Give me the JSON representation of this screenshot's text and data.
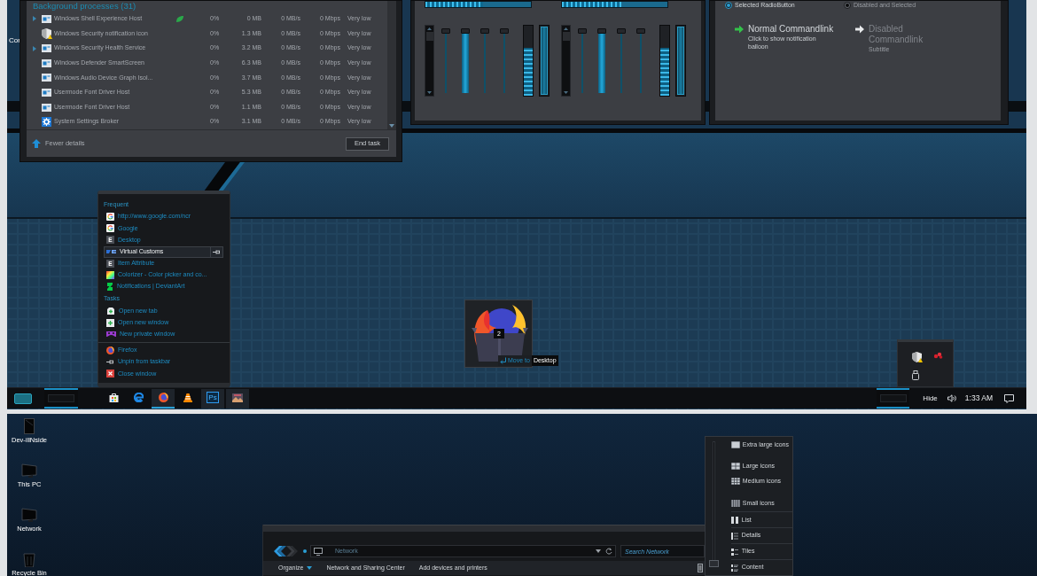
{
  "top_desktop": {
    "partial_label": "Cor"
  },
  "task_manager": {
    "section_title": "Background processes (31)",
    "rows": [
      {
        "name": "Windows Shell Experience Host",
        "cpu": "0%",
        "memory": "0 MB",
        "disk": "0 MB/s",
        "network": "0 Mbps",
        "power": "Very low",
        "expandable": true,
        "suspended": true
      },
      {
        "name": "Windows Security notification icon",
        "cpu": "0%",
        "memory": "1.3 MB",
        "disk": "0 MB/s",
        "network": "0 Mbps",
        "power": "Very low",
        "expandable": false,
        "suspended": false
      },
      {
        "name": "Windows Security Health Service",
        "cpu": "0%",
        "memory": "3.2 MB",
        "disk": "0 MB/s",
        "network": "0 Mbps",
        "power": "Very low",
        "expandable": true,
        "suspended": false
      },
      {
        "name": "Windows Defender SmartScreen",
        "cpu": "0%",
        "memory": "6.3 MB",
        "disk": "0 MB/s",
        "network": "0 Mbps",
        "power": "Very low",
        "expandable": false,
        "suspended": false
      },
      {
        "name": "Windows Audio Device Graph Isol...",
        "cpu": "0%",
        "memory": "3.7 MB",
        "disk": "0 MB/s",
        "network": "0 Mbps",
        "power": "Very low",
        "expandable": false,
        "suspended": false
      },
      {
        "name": "Usermode Font Driver Host",
        "cpu": "0%",
        "memory": "5.3 MB",
        "disk": "0 MB/s",
        "network": "0 Mbps",
        "power": "Very low",
        "expandable": false,
        "suspended": false
      },
      {
        "name": "Usermode Font Driver Host",
        "cpu": "0%",
        "memory": "1.1 MB",
        "disk": "0 MB/s",
        "network": "0 Mbps",
        "power": "Very low",
        "expandable": false,
        "suspended": false
      },
      {
        "name": "System Settings Broker",
        "cpu": "0%",
        "memory": "3.1 MB",
        "disk": "0 MB/s",
        "network": "0 Mbps",
        "power": "Very low",
        "expandable": false,
        "suspended": false
      }
    ],
    "fewer_details": "Fewer details",
    "end_task": "End task"
  },
  "slider_demo": {
    "progress_bars": [
      {
        "level": 0.55
      },
      {
        "level": 0.56
      }
    ],
    "groups": [
      {
        "sliders": [
          {
            "kind": "thin",
            "level": 1
          },
          {
            "kind": "filled",
            "level": 1
          },
          {
            "kind": "thin",
            "level": 1
          },
          {
            "kind": "thin",
            "level": 1
          }
        ],
        "meters": [
          {
            "kind": "chevron",
            "level": 0.68
          },
          {
            "kind": "solid",
            "level": 1
          }
        ]
      },
      {
        "sliders": [
          {
            "kind": "thin",
            "level": 1
          },
          {
            "kind": "filled",
            "level": 1
          },
          {
            "kind": "thin",
            "level": 1
          },
          {
            "kind": "thin",
            "level": 1
          }
        ],
        "meters": [
          {
            "kind": "chevron",
            "level": 0.68
          },
          {
            "kind": "solid",
            "level": 1
          }
        ]
      }
    ]
  },
  "options_demo": {
    "radio_buttons": [
      {
        "label": "Selected RadioButton",
        "selected": true,
        "disabled": false
      },
      {
        "label": "Disabled and Selected",
        "selected": true,
        "disabled": true
      }
    ],
    "command_links": [
      {
        "title": "Normal Commandlink",
        "subtitle": "Click to show notification balloon",
        "disabled": false
      },
      {
        "title": "Disabled Commandlink",
        "subtitle": "Subtitle",
        "disabled": true
      }
    ]
  },
  "jump_list": {
    "sections": [
      {
        "title": "Frequent",
        "items": [
          {
            "label": "http://www.google.com/ncr",
            "selected": false
          },
          {
            "label": "Google",
            "selected": false
          },
          {
            "label": "Desktop",
            "selected": false,
            "icon_text": "E"
          },
          {
            "label": "Virtual Customs",
            "selected": true
          },
          {
            "label": "Item Attribute",
            "selected": false,
            "icon_text": "E"
          },
          {
            "label": "Colorizer - Color picker and co...",
            "selected": false
          },
          {
            "label": "Notifications | DeviantArt",
            "selected": false
          }
        ]
      },
      {
        "title": "Tasks",
        "items": [
          {
            "label": "Open new tab",
            "selected": false
          },
          {
            "label": "Open new window",
            "selected": false
          },
          {
            "label": "New private window",
            "selected": false
          }
        ]
      }
    ],
    "footer_items": [
      {
        "label": "Firefox",
        "selected": false
      },
      {
        "label": "Unpin from taskbar",
        "selected": false
      },
      {
        "label": "Close window",
        "selected": false
      }
    ]
  },
  "thumbnail": {
    "badge": "2",
    "action": "Move to",
    "target": "Desktop"
  },
  "taskbar": {
    "apps": [
      {
        "running": false,
        "selected": false
      },
      {
        "running": false,
        "selected": false
      },
      {
        "running": true,
        "selected": true
      },
      {
        "running": false,
        "selected": false
      },
      {
        "running": true,
        "selected": false,
        "icon_text": "Ps"
      },
      {
        "running": true,
        "selected": false
      }
    ],
    "hide_label": "Hide",
    "clock": "1:33 AM"
  },
  "bottom_desktop": {
    "icons": [
      {
        "label": "Dev-illNside"
      },
      {
        "label": "This PC"
      },
      {
        "label": "Network"
      },
      {
        "label": "Recycle Bin"
      }
    ]
  },
  "explorer": {
    "address": "Network",
    "search": {
      "placeholder": "Search Network"
    },
    "toolbar": [
      {
        "label": "Organize",
        "dropdown": true
      },
      {
        "label": "Network and Sharing Center",
        "dropdown": false
      },
      {
        "label": "Add devices and printers",
        "dropdown": false
      }
    ]
  },
  "view_menu": {
    "level": 0,
    "items": [
      {
        "label": "Extra large icons",
        "kind": "size"
      },
      {
        "label": "Large icons",
        "kind": "size"
      },
      {
        "label": "Medium icons",
        "kind": "size"
      },
      {
        "label": "Small icons",
        "kind": "size"
      },
      {
        "label": "List",
        "kind": "layout"
      },
      {
        "label": "Details",
        "kind": "layout"
      },
      {
        "label": "Tiles",
        "kind": "layout"
      },
      {
        "label": "Content",
        "kind": "layout"
      }
    ]
  }
}
